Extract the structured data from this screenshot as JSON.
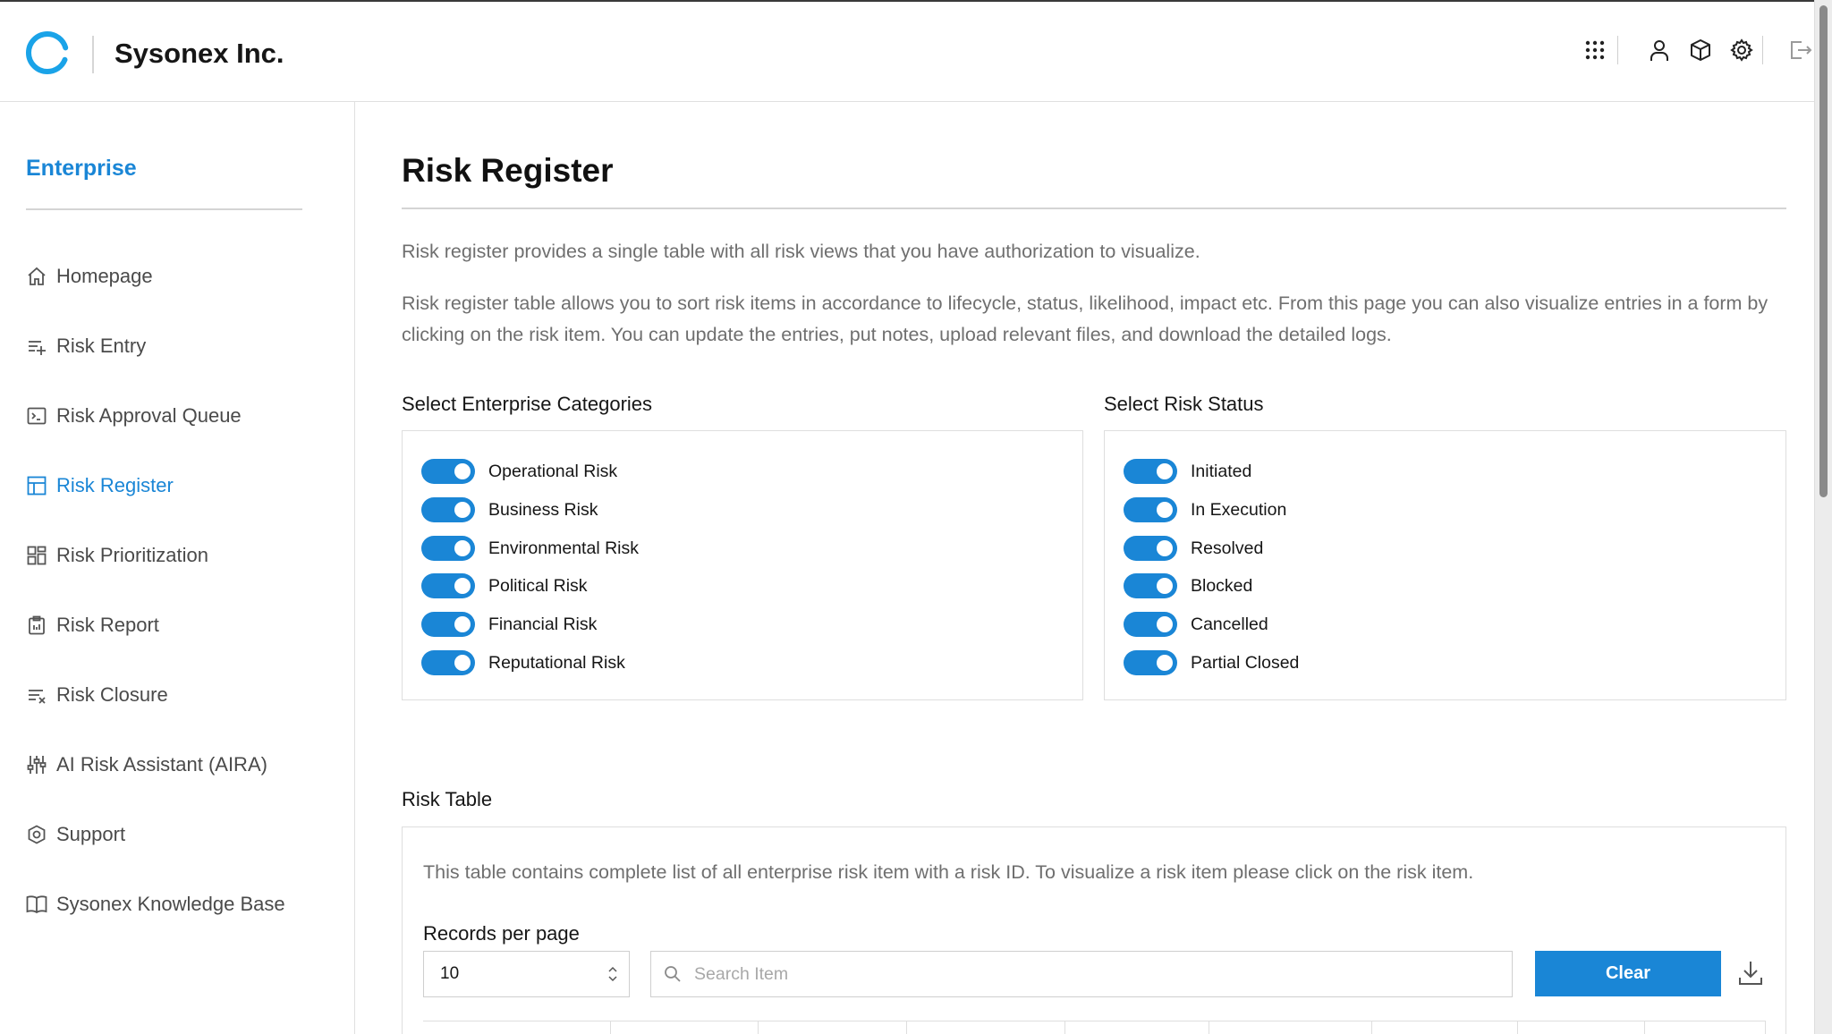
{
  "header": {
    "brand": "Sysonex Inc.",
    "icons": [
      "apps-grid-icon",
      "user-icon",
      "cube-icon",
      "settings-icon",
      "logout-icon"
    ]
  },
  "sidebar": {
    "title": "Enterprise",
    "items": [
      {
        "label": "Homepage",
        "icon": "home-icon"
      },
      {
        "label": "Risk Entry",
        "icon": "list-add-icon"
      },
      {
        "label": "Risk Approval Queue",
        "icon": "terminal-icon"
      },
      {
        "label": "Risk Register",
        "icon": "table-icon",
        "active": true
      },
      {
        "label": "Risk Prioritization",
        "icon": "dashboard-icon"
      },
      {
        "label": "Risk Report",
        "icon": "clipboard-icon"
      },
      {
        "label": "Risk Closure",
        "icon": "list-remove-icon"
      },
      {
        "label": "AI Risk Assistant (AIRA)",
        "icon": "sliders-icon"
      },
      {
        "label": "Support",
        "icon": "support-icon"
      },
      {
        "label": "Sysonex Knowledge Base",
        "icon": "book-icon"
      }
    ]
  },
  "main": {
    "title": "Risk Register",
    "description_1": "Risk register provides a single table with all risk views that you have authorization to visualize.",
    "description_2": "Risk register table allows you to sort risk items in accordance to lifecycle, status, likelihood, impact etc. From this page you can also visualize entries in a form by clicking on the risk item. You can update the entries, put notes, upload relevant files, and download the detailed logs.",
    "categories": {
      "label": "Select Enterprise Categories",
      "items": [
        {
          "label": "Operational Risk",
          "on": true
        },
        {
          "label": "Business Risk",
          "on": true
        },
        {
          "label": "Environmental Risk",
          "on": true
        },
        {
          "label": "Political Risk",
          "on": true
        },
        {
          "label": "Financial Risk",
          "on": true
        },
        {
          "label": "Reputational Risk",
          "on": true
        }
      ]
    },
    "status": {
      "label": "Select Risk Status",
      "items": [
        {
          "label": "Initiated",
          "on": true
        },
        {
          "label": "In Execution",
          "on": true
        },
        {
          "label": "Resolved",
          "on": true
        },
        {
          "label": "Blocked",
          "on": true
        },
        {
          "label": "Cancelled",
          "on": true
        },
        {
          "label": "Partial Closed",
          "on": true
        }
      ]
    },
    "risk_table": {
      "label": "Risk Table",
      "description": "This table contains complete list of all enterprise risk item with a risk ID. To visualize a risk item please click on the risk item.",
      "records_label": "Records per page",
      "records_value": "10",
      "search_placeholder": "Search Item",
      "clear_label": "Clear"
    }
  },
  "colors": {
    "accent": "#1a86d6",
    "text": "#161616",
    "muted": "#6f6f6f",
    "border": "#dedede"
  }
}
